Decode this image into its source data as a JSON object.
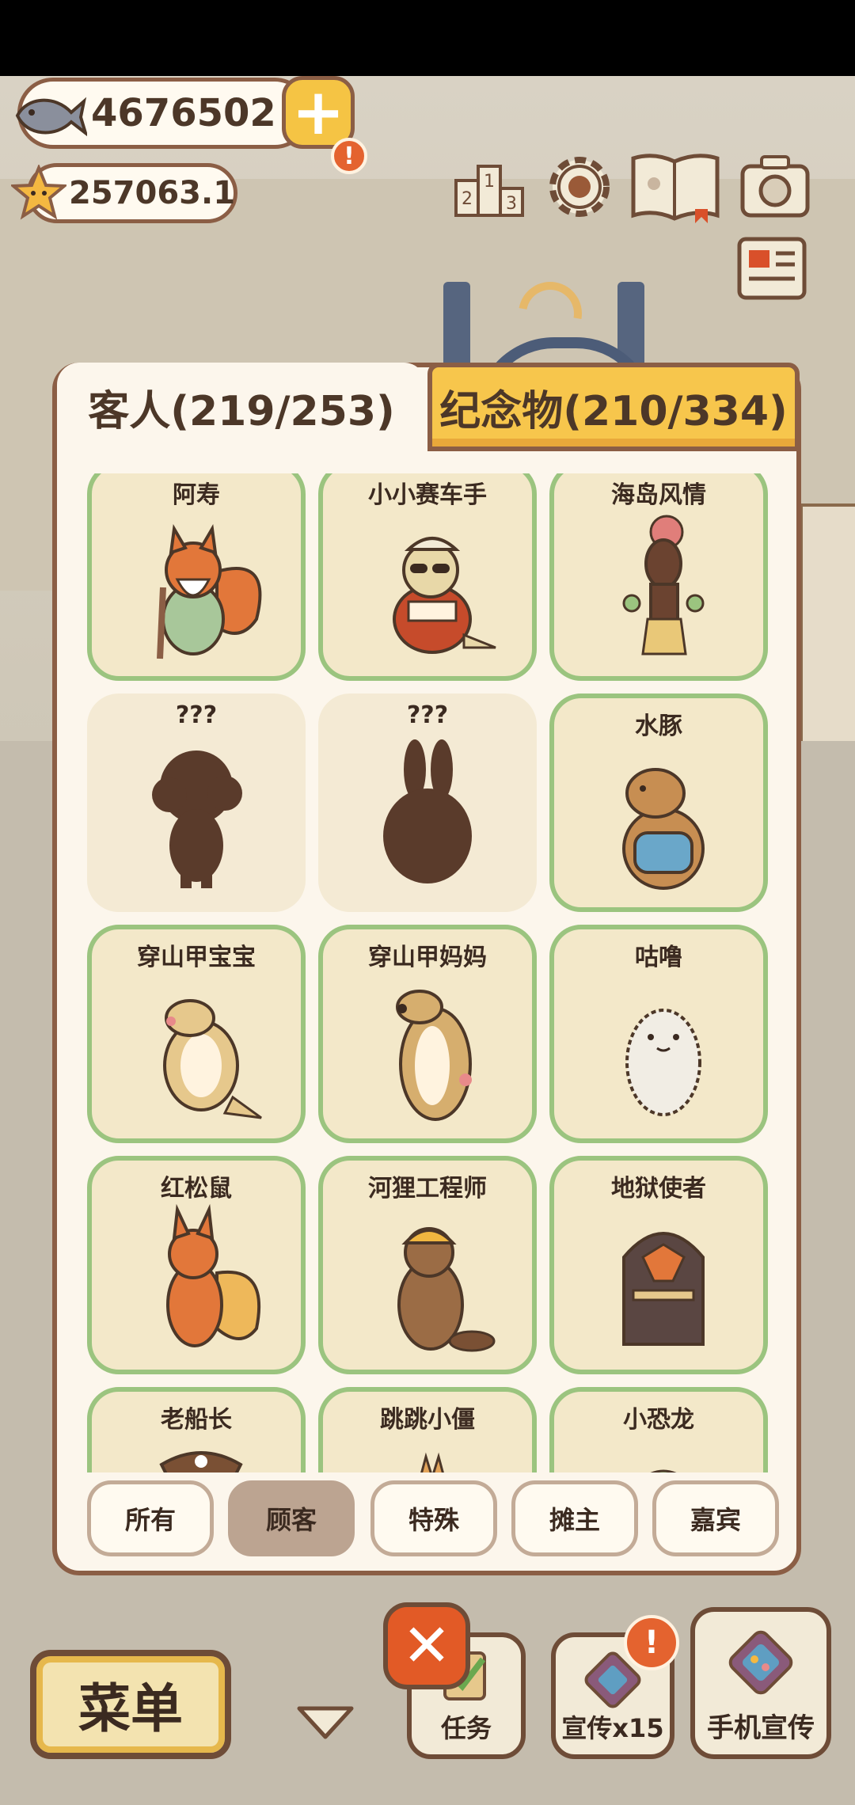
{
  "currency": {
    "fish": "4676502",
    "stars": "257063.1",
    "alert": "!"
  },
  "tabs": {
    "guests": "客人(219/253)",
    "souvenirs": "纪念物(210/334)"
  },
  "cards": [
    {
      "name": "阿寿",
      "locked": false
    },
    {
      "name": "小小赛车手",
      "locked": false
    },
    {
      "name": "海岛风情",
      "locked": false
    },
    {
      "name": "???",
      "locked": true
    },
    {
      "name": "???",
      "locked": true
    },
    {
      "name": "水豚",
      "locked": false
    },
    {
      "name": "穿山甲宝宝",
      "locked": false
    },
    {
      "name": "穿山甲妈妈",
      "locked": false
    },
    {
      "name": "咕噜",
      "locked": false
    },
    {
      "name": "红松鼠",
      "locked": false
    },
    {
      "name": "河狸工程师",
      "locked": false
    },
    {
      "name": "地狱使者",
      "locked": false
    },
    {
      "name": "老船长",
      "locked": false
    },
    {
      "name": "跳跳小僵",
      "locked": false
    },
    {
      "name": "小恐龙",
      "locked": false
    }
  ],
  "filters": {
    "all": "所有",
    "customers": "顾客",
    "special": "特殊",
    "vendors": "摊主",
    "guests": "嘉宾",
    "active": "顾客"
  },
  "bottom": {
    "menu": "菜单",
    "tasks": "任务",
    "promo": "宣传x15",
    "phone_promo": "手机宣传",
    "alert": "!"
  },
  "colors": {
    "accent_yellow": "#f7c64c",
    "card_border_green": "#9bc47f",
    "close_orange": "#e25a26",
    "frame_brown": "#8b5e45"
  },
  "icons": [
    "fish-icon",
    "plus-icon",
    "star-icon",
    "ranking-icon",
    "gear-icon",
    "book-icon",
    "camera-icon",
    "newspaper-icon",
    "close-icon",
    "chevron-down-icon",
    "task-icon",
    "promo-icon",
    "phone-icon"
  ]
}
